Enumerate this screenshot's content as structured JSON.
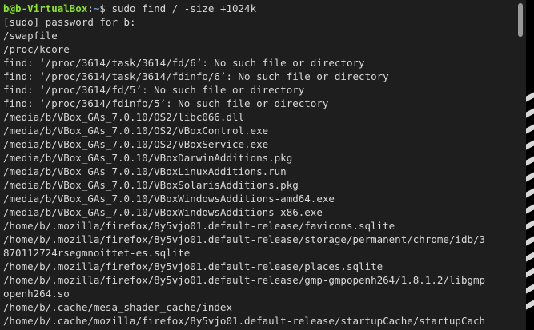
{
  "prompt": {
    "user_host": "b@b-VirtualBox",
    "separator": ":",
    "cwd": "~",
    "symbol": "$",
    "command": " sudo find / -size +1024k"
  },
  "output_lines": [
    "[sudo] password for b:",
    "/swapfile",
    "/proc/kcore",
    "find: ‘/proc/3614/task/3614/fd/6’: No such file or directory",
    "find: ‘/proc/3614/task/3614/fdinfo/6’: No such file or directory",
    "find: ‘/proc/3614/fd/5’: No such file or directory",
    "find: ‘/proc/3614/fdinfo/5’: No such file or directory",
    "/media/b/VBox_GAs_7.0.10/OS2/libc066.dll",
    "/media/b/VBox_GAs_7.0.10/OS2/VBoxControl.exe",
    "/media/b/VBox_GAs_7.0.10/OS2/VBoxService.exe",
    "/media/b/VBox_GAs_7.0.10/VBoxDarwinAdditions.pkg",
    "/media/b/VBox_GAs_7.0.10/VBoxLinuxAdditions.run",
    "/media/b/VBox_GAs_7.0.10/VBoxSolarisAdditions.pkg",
    "/media/b/VBox_GAs_7.0.10/VBoxWindowsAdditions-amd64.exe",
    "/media/b/VBox_GAs_7.0.10/VBoxWindowsAdditions-x86.exe",
    "/home/b/.mozilla/firefox/8y5vjo01.default-release/favicons.sqlite",
    "/home/b/.mozilla/firefox/8y5vjo01.default-release/storage/permanent/chrome/idb/3",
    "870112724rsegmnoittet-es.sqlite",
    "/home/b/.mozilla/firefox/8y5vjo01.default-release/places.sqlite",
    "/home/b/.mozilla/firefox/8y5vjo01.default-release/gmp-gmpopenh264/1.8.1.2/libgmp",
    "openh264.so",
    "/home/b/.cache/mesa_shader_cache/index",
    "/home/b/.cache/mozilla/firefox/8y5vjo01.default-release/startupCache/startupCach"
  ],
  "colors": {
    "terminal_bg": "#1e1e1e",
    "text": "#d8d8d8",
    "user_host": "#8ae234",
    "path": "#729fcf"
  }
}
